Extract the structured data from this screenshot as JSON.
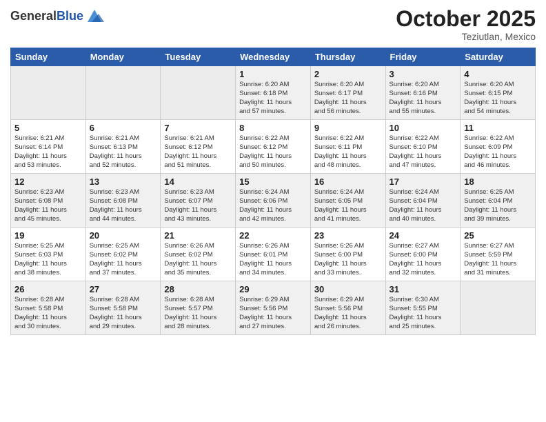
{
  "header": {
    "logo_general": "General",
    "logo_blue": "Blue",
    "month": "October 2025",
    "location": "Teziutlan, Mexico"
  },
  "weekdays": [
    "Sunday",
    "Monday",
    "Tuesday",
    "Wednesday",
    "Thursday",
    "Friday",
    "Saturday"
  ],
  "weeks": [
    [
      {
        "day": "",
        "info": ""
      },
      {
        "day": "",
        "info": ""
      },
      {
        "day": "",
        "info": ""
      },
      {
        "day": "1",
        "info": "Sunrise: 6:20 AM\nSunset: 6:18 PM\nDaylight: 11 hours\nand 57 minutes."
      },
      {
        "day": "2",
        "info": "Sunrise: 6:20 AM\nSunset: 6:17 PM\nDaylight: 11 hours\nand 56 minutes."
      },
      {
        "day": "3",
        "info": "Sunrise: 6:20 AM\nSunset: 6:16 PM\nDaylight: 11 hours\nand 55 minutes."
      },
      {
        "day": "4",
        "info": "Sunrise: 6:20 AM\nSunset: 6:15 PM\nDaylight: 11 hours\nand 54 minutes."
      }
    ],
    [
      {
        "day": "5",
        "info": "Sunrise: 6:21 AM\nSunset: 6:14 PM\nDaylight: 11 hours\nand 53 minutes."
      },
      {
        "day": "6",
        "info": "Sunrise: 6:21 AM\nSunset: 6:13 PM\nDaylight: 11 hours\nand 52 minutes."
      },
      {
        "day": "7",
        "info": "Sunrise: 6:21 AM\nSunset: 6:12 PM\nDaylight: 11 hours\nand 51 minutes."
      },
      {
        "day": "8",
        "info": "Sunrise: 6:22 AM\nSunset: 6:12 PM\nDaylight: 11 hours\nand 50 minutes."
      },
      {
        "day": "9",
        "info": "Sunrise: 6:22 AM\nSunset: 6:11 PM\nDaylight: 11 hours\nand 48 minutes."
      },
      {
        "day": "10",
        "info": "Sunrise: 6:22 AM\nSunset: 6:10 PM\nDaylight: 11 hours\nand 47 minutes."
      },
      {
        "day": "11",
        "info": "Sunrise: 6:22 AM\nSunset: 6:09 PM\nDaylight: 11 hours\nand 46 minutes."
      }
    ],
    [
      {
        "day": "12",
        "info": "Sunrise: 6:23 AM\nSunset: 6:08 PM\nDaylight: 11 hours\nand 45 minutes."
      },
      {
        "day": "13",
        "info": "Sunrise: 6:23 AM\nSunset: 6:08 PM\nDaylight: 11 hours\nand 44 minutes."
      },
      {
        "day": "14",
        "info": "Sunrise: 6:23 AM\nSunset: 6:07 PM\nDaylight: 11 hours\nand 43 minutes."
      },
      {
        "day": "15",
        "info": "Sunrise: 6:24 AM\nSunset: 6:06 PM\nDaylight: 11 hours\nand 42 minutes."
      },
      {
        "day": "16",
        "info": "Sunrise: 6:24 AM\nSunset: 6:05 PM\nDaylight: 11 hours\nand 41 minutes."
      },
      {
        "day": "17",
        "info": "Sunrise: 6:24 AM\nSunset: 6:04 PM\nDaylight: 11 hours\nand 40 minutes."
      },
      {
        "day": "18",
        "info": "Sunrise: 6:25 AM\nSunset: 6:04 PM\nDaylight: 11 hours\nand 39 minutes."
      }
    ],
    [
      {
        "day": "19",
        "info": "Sunrise: 6:25 AM\nSunset: 6:03 PM\nDaylight: 11 hours\nand 38 minutes."
      },
      {
        "day": "20",
        "info": "Sunrise: 6:25 AM\nSunset: 6:02 PM\nDaylight: 11 hours\nand 37 minutes."
      },
      {
        "day": "21",
        "info": "Sunrise: 6:26 AM\nSunset: 6:02 PM\nDaylight: 11 hours\nand 35 minutes."
      },
      {
        "day": "22",
        "info": "Sunrise: 6:26 AM\nSunset: 6:01 PM\nDaylight: 11 hours\nand 34 minutes."
      },
      {
        "day": "23",
        "info": "Sunrise: 6:26 AM\nSunset: 6:00 PM\nDaylight: 11 hours\nand 33 minutes."
      },
      {
        "day": "24",
        "info": "Sunrise: 6:27 AM\nSunset: 6:00 PM\nDaylight: 11 hours\nand 32 minutes."
      },
      {
        "day": "25",
        "info": "Sunrise: 6:27 AM\nSunset: 5:59 PM\nDaylight: 11 hours\nand 31 minutes."
      }
    ],
    [
      {
        "day": "26",
        "info": "Sunrise: 6:28 AM\nSunset: 5:58 PM\nDaylight: 11 hours\nand 30 minutes."
      },
      {
        "day": "27",
        "info": "Sunrise: 6:28 AM\nSunset: 5:58 PM\nDaylight: 11 hours\nand 29 minutes."
      },
      {
        "day": "28",
        "info": "Sunrise: 6:28 AM\nSunset: 5:57 PM\nDaylight: 11 hours\nand 28 minutes."
      },
      {
        "day": "29",
        "info": "Sunrise: 6:29 AM\nSunset: 5:56 PM\nDaylight: 11 hours\nand 27 minutes."
      },
      {
        "day": "30",
        "info": "Sunrise: 6:29 AM\nSunset: 5:56 PM\nDaylight: 11 hours\nand 26 minutes."
      },
      {
        "day": "31",
        "info": "Sunrise: 6:30 AM\nSunset: 5:55 PM\nDaylight: 11 hours\nand 25 minutes."
      },
      {
        "day": "",
        "info": ""
      }
    ]
  ]
}
